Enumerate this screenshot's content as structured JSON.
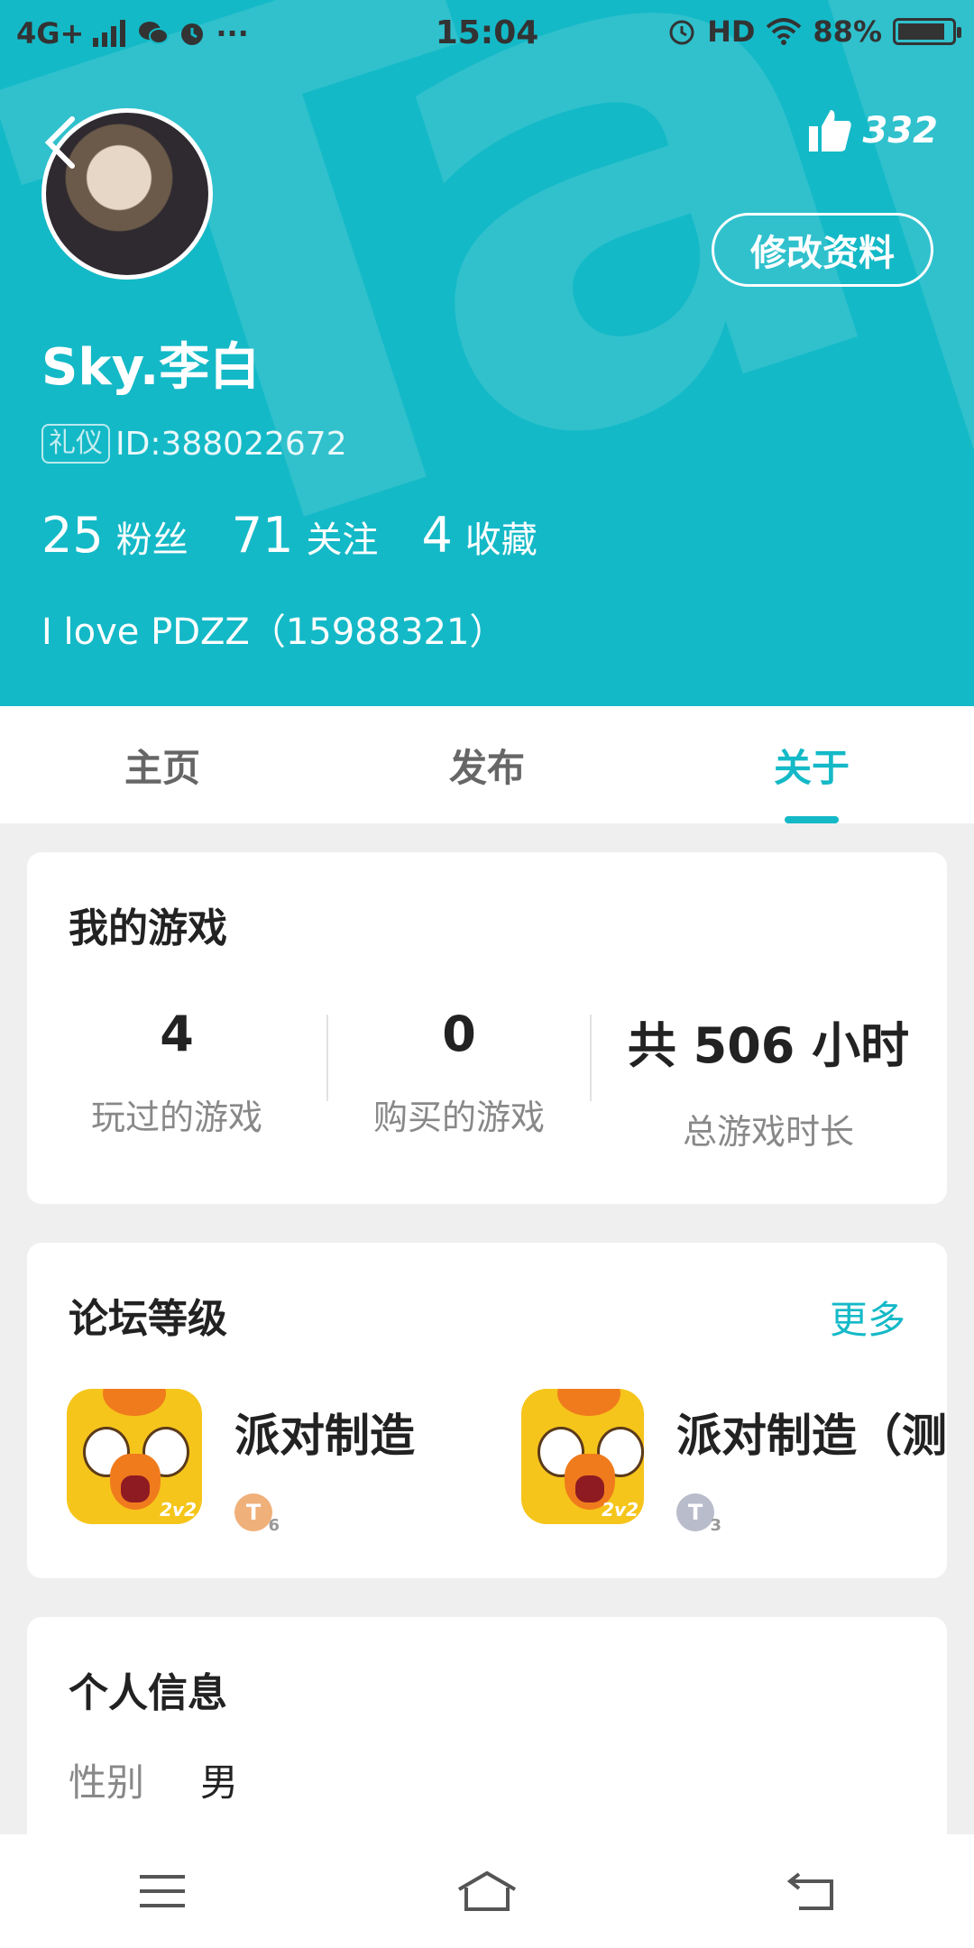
{
  "status_bar": {
    "network": "4G+",
    "time": "15:04",
    "hd": "HD",
    "battery": "88%",
    "battery_level": 0.88
  },
  "header": {
    "like_count": "332",
    "edit_profile_label": "修改资料",
    "username": "Sky.李白",
    "badge": "礼仪",
    "id_text": "ID:388022672",
    "stats": [
      {
        "value": "25",
        "label": "粉丝"
      },
      {
        "value": "71",
        "label": "关注"
      },
      {
        "value": "4",
        "label": "收藏"
      }
    ],
    "bio": "I love PDZZ（15988321）",
    "accent_color": "#14b9c7"
  },
  "tabs": [
    {
      "label": "主页",
      "active": false
    },
    {
      "label": "发布",
      "active": false
    },
    {
      "label": "关于",
      "active": true
    }
  ],
  "my_games": {
    "title": "我的游戏",
    "stats": [
      {
        "value": "4",
        "label": "玩过的游戏"
      },
      {
        "value": "0",
        "label": "购买的游戏"
      },
      {
        "value": "共 506 小时",
        "label": "总游戏时长"
      }
    ]
  },
  "forum_level": {
    "title": "论坛等级",
    "more_label": "更多",
    "items": [
      {
        "name": "派对制造",
        "icon_tag": "2v2",
        "level_letter": "T",
        "level_num": "6",
        "level_color": "#f0b07a"
      },
      {
        "name": "派对制造（测",
        "icon_tag": "2v2",
        "level_letter": "T",
        "level_num": "3",
        "level_color": "#b8bccb"
      }
    ]
  },
  "personal_info": {
    "title": "个人信息",
    "rows": [
      {
        "key": "性别",
        "value": "男"
      }
    ]
  },
  "navbar": {
    "icons": [
      "menu-icon",
      "home-icon",
      "back-icon"
    ]
  }
}
